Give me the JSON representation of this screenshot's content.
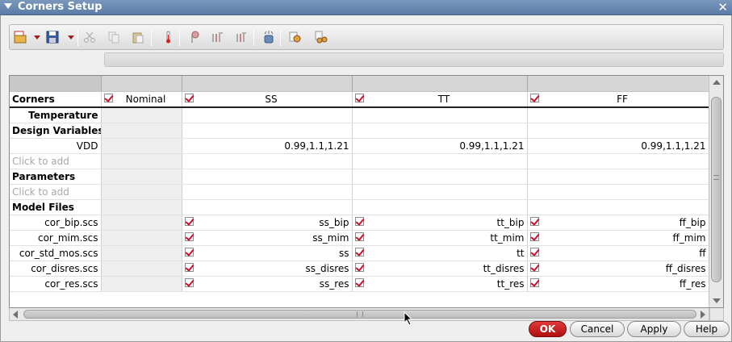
{
  "window": {
    "title": "Corners Setup",
    "close_glyph": "✕"
  },
  "toolbar": {
    "icons": [
      "csv-open-icon",
      "csv-save-icon",
      "cut-icon",
      "copy-icon",
      "paste-icon",
      "temperature-icon",
      "add-variable-icon",
      "add-parameter-icon",
      "remove-parameter-icon",
      "add-model-file-icon",
      "settings-icon",
      "multi-settings-icon"
    ]
  },
  "grid": {
    "header_row_label": "Corners",
    "columns": [
      {
        "label": "Nominal",
        "checked": true
      },
      {
        "label": "SS",
        "checked": true
      },
      {
        "label": "TT",
        "checked": true
      },
      {
        "label": "FF",
        "checked": true
      }
    ],
    "rows": {
      "temperature": "Temperature",
      "design_variables": "Design Variables",
      "vdd": {
        "label": "VDD",
        "values": [
          "0.99,1.1,1.21",
          "0.99,1.1,1.21",
          "0.99,1.1,1.21"
        ]
      },
      "click_to_add_1": "Click to add",
      "parameters": "Parameters",
      "click_to_add_2": "Click to add",
      "model_files": "Model Files",
      "model_rows": [
        {
          "file": "cor_bip.scs",
          "values": [
            "ss_bip",
            "tt_bip",
            "ff_bip"
          ]
        },
        {
          "file": "cor_mim.scs",
          "values": [
            "ss_mim",
            "tt_mim",
            "ff_mim"
          ]
        },
        {
          "file": "cor_std_mos.scs",
          "values": [
            "ss",
            "tt",
            "ff"
          ]
        },
        {
          "file": "cor_disres.scs",
          "values": [
            "ss_disres",
            "tt_disres",
            "ff_disres"
          ]
        },
        {
          "file": "cor_res.scs",
          "values": [
            "ss_res",
            "tt_res",
            "ff_res"
          ]
        }
      ]
    }
  },
  "buttons": {
    "ok": "OK",
    "cancel": "Cancel",
    "apply": "Apply",
    "help": "Help"
  },
  "colors": {
    "titlebar": "#5b7ca6",
    "check": "#c8102e",
    "ok_button": "#c01818"
  }
}
